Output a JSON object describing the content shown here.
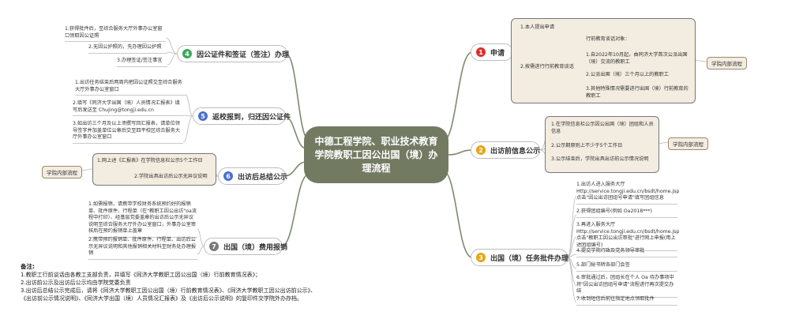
{
  "center": {
    "title": "中德工程学院、职业技术教育学院教职工因公出国（境）办理流程"
  },
  "branches": {
    "b1": {
      "num": "1",
      "label": "申请",
      "color": "#d9302c",
      "leaf_apply": "1.本人提出申请",
      "leaf_edu": "2.按需进行行前教育谈话",
      "edu_head": "行前教育谈话对象：",
      "edu_items": [
        "1.自2022年10月起，由同济大学首次公派出国（境）交流的教职工",
        "2.公派出国（境）三个月以上的教职工",
        "3.其他特殊情况需要进行出国（境）行前教育的教职工"
      ],
      "tag": "学院内部流程"
    },
    "b2": {
      "num": "2",
      "label": "出访前信息公示",
      "color": "#e6a416",
      "items": [
        "1.在学院信息栏公示因公出国（境）团组和人员信息",
        "2.公示期原则上不少于5个工作日",
        "3.公示结束后，学院出具出访前公示情况说明"
      ],
      "tag": "学院内部流程"
    },
    "b3": {
      "num": "3",
      "label": "出国（境）任务批件办理",
      "color": "#e6a416",
      "items": [
        "1.出访人进入服务大厅 Http://service.tongji.edu.cn/bsdt/home.jsp 点击\"因公出访团组号申请\"填写团组信息",
        "2.获得团组编号(例如 Oa2018***)",
        "3.再进入服务大厅 Http://service.tongji.edu.cn/bsdt/home.jsp 点击\"教职工因公出访审批\"进行网上申报(用上述团组编号)",
        "4.提交学院行政及党务领导审批",
        "5.部门秘书转各部门会签",
        "6.审批通过后，团组长在个人 Oa 待办事项中将\"因公出访团组号申请\"流程进行再次提交办结",
        "7.收到短信后前往指定地点领取批件"
      ]
    },
    "b4": {
      "num": "4",
      "label": "因公证件和签证（签注）办理",
      "color": "#3aa85a",
      "items": [
        "1.获得批件后，至综合服务大厅外事办公室窗口领取因公证照",
        "2.无因公护照的，先办理因公护照",
        "3.办理签证/签注事宜"
      ]
    },
    "b5": {
      "num": "5",
      "label": "返校报到，归还因公证件",
      "color": "#4a6fd0",
      "items": [
        "1.出访任务结束后两周内把因公证照交至综合服务大厅外事办公室窗口",
        "2.填写《同济大学出国（境）人员情况汇报表》填写后发送至 Chujing@tongji.edu.cn",
        "3.如出访三个月及以上须撰写回汇报表，请单位领导签字并加盖单位公章后交至四平校区综合服务大厅外事办公室窗口"
      ]
    },
    "b6": {
      "num": "6",
      "label": "出访后总结公示",
      "color": "#4a6fd0",
      "items": [
        "1.网上述《汇报表》在学院信息栏公示5个工作日",
        "2.学院出具出访后公示无异议说明"
      ],
      "tag": "学院内部流程"
    },
    "b7": {
      "num": "7",
      "label": "出国（境）费用报销",
      "color": "#7a7a7a",
      "items": [
        "1.如需报销，请携带学校财务系统预约好的报销单、批件原件、行程单（在\"教职工因公出访\"oa流程中打印）、经基层党委盖章的出访后公示无异议说明至综合服务大厅外办公室窗口，外事办公室审核后在预约报销单上盖章",
        "2.携带预约报销单、批件原件、行程单、出访后公示无异议说明和其他报销相关材料至财务处办理报销"
      ]
    }
  },
  "notes": {
    "title": "备注:",
    "lines": [
      "1.教职工行前谈话由各教工支部负责，并填写《同济大学教职工因公出国（境）行前教育情况表》；",
      "2.出访前公示及出访后公示均由学院党委负责",
      "3.出访后总结公示完成后，请将《同济大学教职工因公出国（境）行前教育情况表》、《同济大学教职工因公出访前公示》、",
      "《出访前公示情况说明》、《同济大学出国（境）人员情况汇报表》及《出访后公示说明》的复印件交学院外办存档。"
    ]
  }
}
